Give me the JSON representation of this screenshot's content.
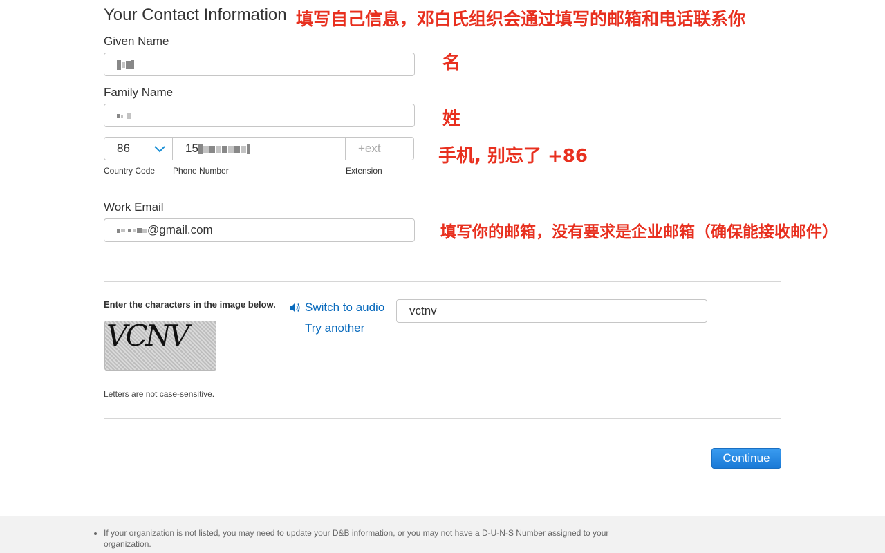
{
  "section_title": "Your Contact Information",
  "annotations": {
    "header_note": "填写自己信息，邓白氏组织会通过填写的邮箱和电话联系你",
    "given_note": "名",
    "family_note": "姓",
    "phone_note": "手机, 别忘了 +86",
    "email_note": "填写你的邮箱，没有要求是企业邮箱（确保能接收邮件）"
  },
  "form": {
    "given_name_label": "Given Name",
    "family_name_label": "Family Name",
    "country_code_value": "86",
    "phone_prefix": "15",
    "extension_placeholder": "+ext",
    "country_code_label": "Country Code",
    "phone_number_label": "Phone Number",
    "extension_label": "Extension",
    "work_email_label": "Work Email",
    "email_suffix": "@gmail.com"
  },
  "captcha": {
    "instruction": "Enter the characters in the image below.",
    "switch_audio": "Switch to audio",
    "try_another": "Try another",
    "input_value": "vctnv",
    "image_text": "VCNV",
    "note": "Letters are not case-sensitive."
  },
  "continue_label": "Continue",
  "footer_text": "If your organization is not listed, you may need to update your D&B information, or you may not have a D-U-N-S Number assigned to your organization.",
  "colors": {
    "accent": "#0a6bbd",
    "annotation": "#e8301f",
    "button": "#1a79d6"
  }
}
